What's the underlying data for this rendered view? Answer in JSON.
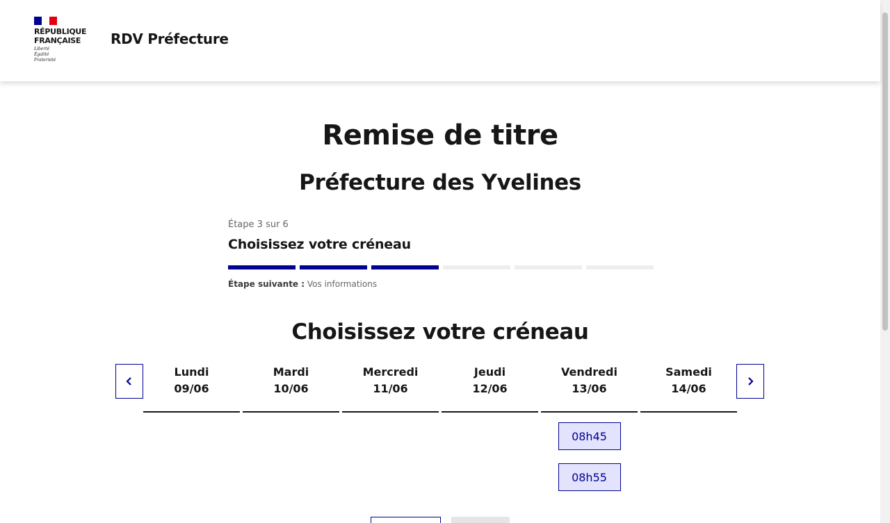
{
  "header": {
    "logo_text": "RÉPUBLIQUE\nFRANÇAISE",
    "logo_motto": "Liberté\nÉgalité\nFraternité",
    "service_title": "RDV Préfecture"
  },
  "page": {
    "title": "Remise de titre",
    "subtitle": "Préfecture des Yvelines"
  },
  "stepper": {
    "state": "Étape 3 sur 6",
    "current_title": "Choisissez votre créneau",
    "current_step": 3,
    "total_steps": 6,
    "next_label": "Étape suivante :",
    "next_value": "Vos informations"
  },
  "calendar": {
    "title": "Choisissez votre créneau",
    "prev_icon": "chevron-left-icon",
    "next_icon": "chevron-right-icon",
    "days": [
      {
        "name": "Lundi",
        "date": "09/06",
        "slots": []
      },
      {
        "name": "Mardi",
        "date": "10/06",
        "slots": []
      },
      {
        "name": "Mercredi",
        "date": "11/06",
        "slots": []
      },
      {
        "name": "Jeudi",
        "date": "12/06",
        "slots": []
      },
      {
        "name": "Vendredi",
        "date": "13/06",
        "slots": [
          "08h45",
          "08h55"
        ]
      },
      {
        "name": "Samedi",
        "date": "14/06",
        "slots": []
      }
    ]
  },
  "colors": {
    "primary": "#000091",
    "slot_bg": "#e3e3fd",
    "flag_red": "#e1000f"
  }
}
